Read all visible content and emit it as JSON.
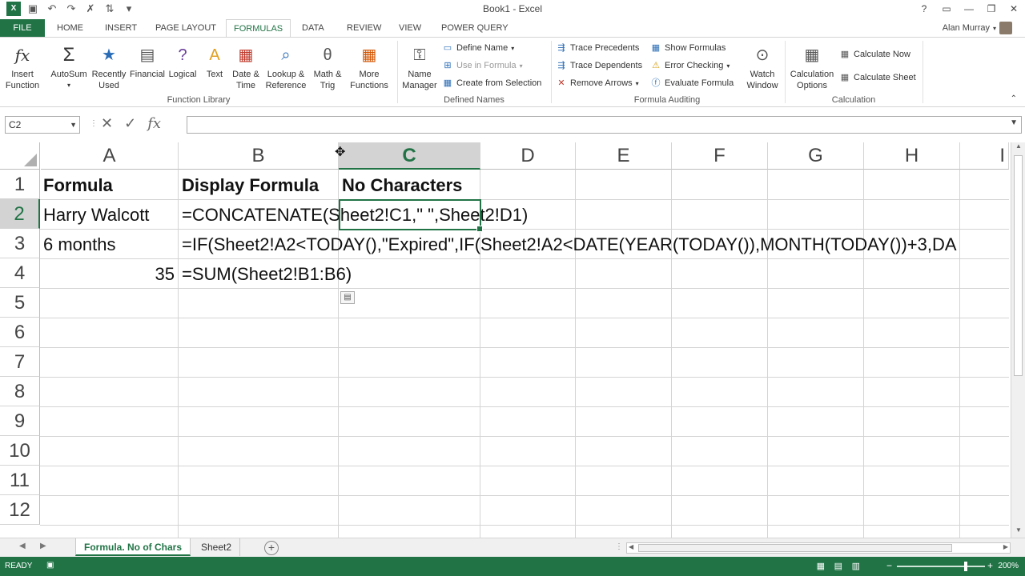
{
  "window": {
    "title": "Book1 - Excel"
  },
  "tabs": [
    "FILE",
    "HOME",
    "INSERT",
    "PAGE LAYOUT",
    "FORMULAS",
    "DATA",
    "REVIEW",
    "VIEW",
    "POWER QUERY"
  ],
  "user": {
    "name": "Alan Murray"
  },
  "ribbon": {
    "function_library": {
      "label": "Function Library",
      "insert_function": "Insert Function",
      "autosum": "AutoSum",
      "recently_used": "Recently Used",
      "financial": "Financial",
      "logical": "Logical",
      "text": "Text",
      "date_time": "Date & Time",
      "lookup_reference": "Lookup & Reference",
      "math_trig": "Math & Trig",
      "more_functions": "More Functions"
    },
    "defined_names": {
      "label": "Defined Names",
      "name_manager": "Name Manager",
      "define_name": "Define Name",
      "use_in_formula": "Use in Formula",
      "create_from_selection": "Create from Selection"
    },
    "formula_auditing": {
      "label": "Formula Auditing",
      "trace_precedents": "Trace Precedents",
      "trace_dependents": "Trace Dependents",
      "remove_arrows": "Remove Arrows",
      "show_formulas": "Show Formulas",
      "error_checking": "Error Checking",
      "evaluate_formula": "Evaluate Formula",
      "watch_window": "Watch Window"
    },
    "calculation": {
      "label": "Calculation",
      "calculation_options": "Calculation Options",
      "calculate_now": "Calculate Now",
      "calculate_sheet": "Calculate Sheet"
    }
  },
  "formula_bar": {
    "name_box": "C2",
    "formula": ""
  },
  "columns": [
    "A",
    "B",
    "C",
    "D",
    "E",
    "F",
    "G",
    "H",
    "I"
  ],
  "rows": [
    "1",
    "2",
    "3",
    "4",
    "5",
    "6",
    "7",
    "8",
    "9",
    "10",
    "11",
    "12"
  ],
  "cells": {
    "A1": "Formula",
    "B1": "Display Formula",
    "C1": "No Characters",
    "A2": "Harry Walcott",
    "B2": "=CONCATENATE(Sheet2!C1,\" \",Sheet2!D1)",
    "A3": "6 months",
    "B3": "=IF(Sheet2!A2<TODAY(),\"Expired\",IF(Sheet2!A2<DATE(YEAR(TODAY()),MONTH(TODAY())+3,DA",
    "A4": "35",
    "B4": "=SUM(Sheet2!B1:B6)"
  },
  "selected_cell": "C2",
  "sheets": [
    "Formula. No of Chars",
    "Sheet2"
  ],
  "active_sheet": "Formula. No of Chars",
  "status": {
    "mode": "READY",
    "zoom": "200%"
  },
  "colors": {
    "accent": "#217346"
  }
}
